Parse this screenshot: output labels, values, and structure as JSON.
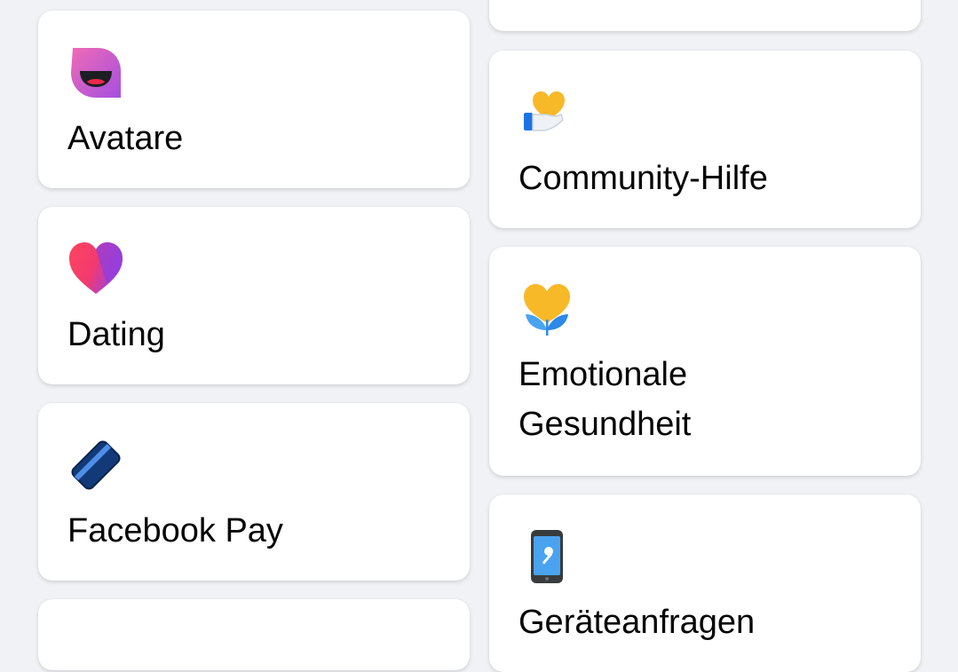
{
  "left_column": [
    {
      "label": "Avatare",
      "icon": "avatar-icon"
    },
    {
      "label": "Dating",
      "icon": "dating-heart-icon"
    },
    {
      "label": "Facebook Pay",
      "icon": "payment-card-icon"
    }
  ],
  "right_column": [
    {
      "label": "Community-Hilfe",
      "icon": "community-help-icon"
    },
    {
      "label_line1": "Emotionale",
      "label_line2": "Gesundheit",
      "icon": "emotional-health-icon"
    },
    {
      "label": "Geräteanfragen",
      "icon": "device-requests-icon"
    }
  ]
}
